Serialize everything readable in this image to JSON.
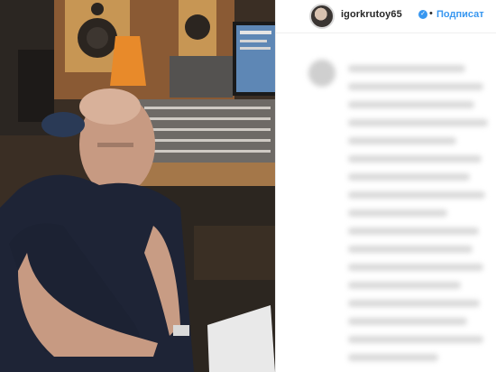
{
  "post": {
    "username": "igorkrutoy65",
    "verified_icon": "verified-check-icon",
    "separator": "•",
    "follow_label": "Подписат"
  },
  "colors": {
    "accent": "#3897f0",
    "text": "#262626",
    "border": "#efefef"
  }
}
